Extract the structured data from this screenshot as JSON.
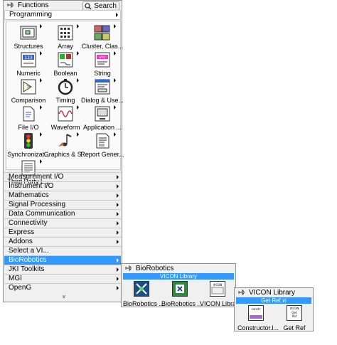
{
  "main_palette": {
    "title": "Functions",
    "search_label": "Search",
    "programming_label": "Programming",
    "programming_items": [
      "Structures",
      "Array",
      "Cluster, Clas...",
      "Numeric",
      "Boolean",
      "String",
      "Comparison",
      "Timing",
      "Dialog & Use...",
      "File I/O",
      "Waveform",
      "Application ...",
      "Synchronizat...",
      "Graphics & S...",
      "Report Gener...",
      "Third Party L..."
    ],
    "categories": [
      "Measurement I/O",
      "Instrument I/O",
      "Mathematics",
      "Signal Processing",
      "Data Communication",
      "Connectivity",
      "Express",
      "Addons",
      "Select a VI...",
      "BioRobotics",
      "JKI Toolkits",
      "MGI",
      "OpenG"
    ],
    "selected_category": "BioRobotics",
    "more_glyph": "»"
  },
  "biorobotics_palette": {
    "title": "BioRobotics",
    "header_label": "VICON Library",
    "items": [
      "BioRobotics ...",
      "BioRobotics ...",
      "VICON Library"
    ]
  },
  "vicon_palette": {
    "title": "VICON Library",
    "header_label": "Get Ref.vi",
    "items": [
      "Constructor.l...",
      "Get Ref"
    ]
  },
  "colors": {
    "selection": "#3399ff",
    "palette_bg": "#f0f0f0",
    "panel_bg": "#fafafa"
  }
}
